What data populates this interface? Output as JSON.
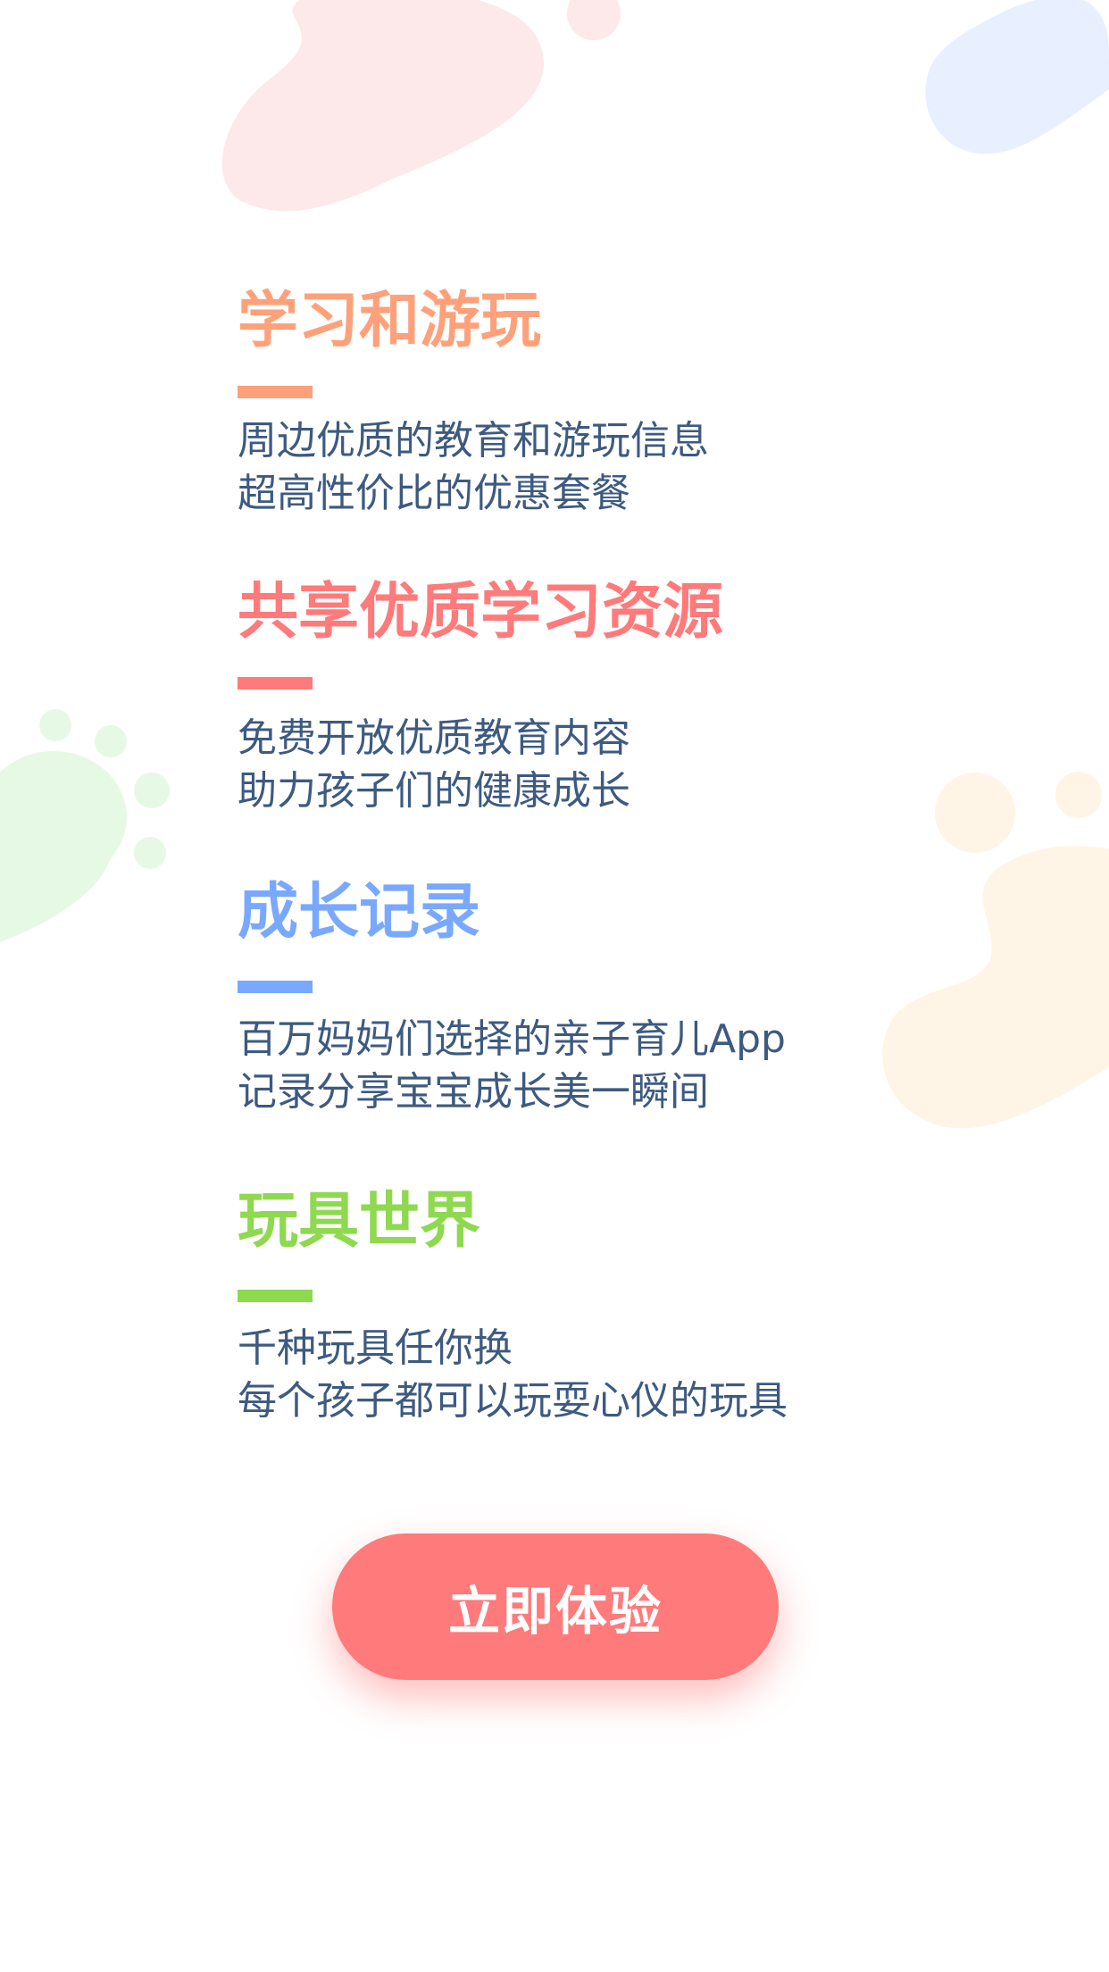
{
  "colors": {
    "learn_play": "#fea17a",
    "share_resources": "#ff7a7a",
    "growth_record": "#79a8ff",
    "toy_world": "#8ed94f",
    "body_text": "#3d5a80",
    "cta_background": "#ff7a7a",
    "cta_text": "#ffffff"
  },
  "sections": [
    {
      "title": "学习和游玩",
      "lines": [
        "周边优质的教育和游玩信息",
        "超高性价比的优惠套餐"
      ]
    },
    {
      "title": "共享优质学习资源",
      "lines": [
        "免费开放优质教育内容",
        "助力孩子们的健康成长"
      ]
    },
    {
      "title": "成长记录",
      "lines": [
        "百万妈妈们选择的亲子育儿App",
        "记录分享宝宝成长美一瞬间"
      ]
    },
    {
      "title": "玩具世界",
      "lines": [
        "千种玩具任你换",
        "每个孩子都可以玩耍心仪的玩具"
      ]
    }
  ],
  "cta": {
    "label": "立即体验"
  }
}
